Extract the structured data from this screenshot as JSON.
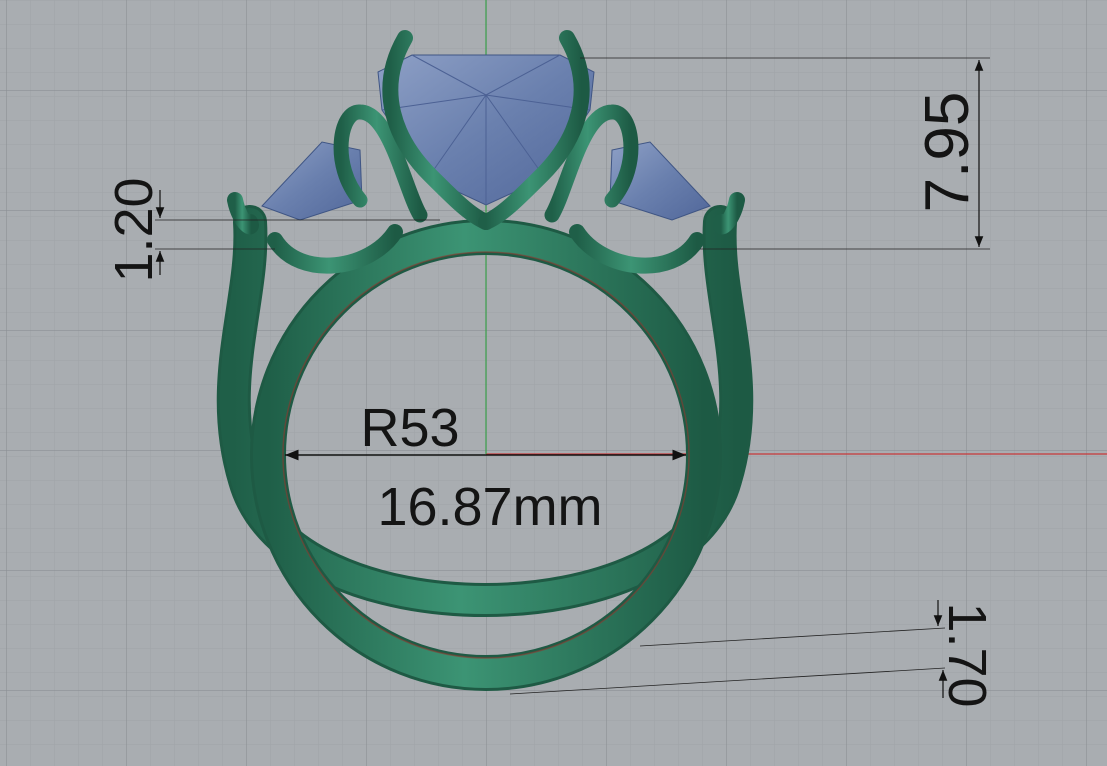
{
  "viewport": {
    "background": "#a9adb1",
    "grid_minor": "#9fa3a8",
    "grid_major": "#8f9398",
    "axis_x_color": "#c8383a",
    "axis_y_color": "#3aa04a"
  },
  "model": {
    "metal_color": "#2f7d62",
    "gem_color": "#6f86b4"
  },
  "dimensions": {
    "ring_size": "R53",
    "inner_diameter": "16.87mm",
    "gem_height": "7.95",
    "prong_gap": "1.20",
    "shank_thickness": "1.70"
  }
}
